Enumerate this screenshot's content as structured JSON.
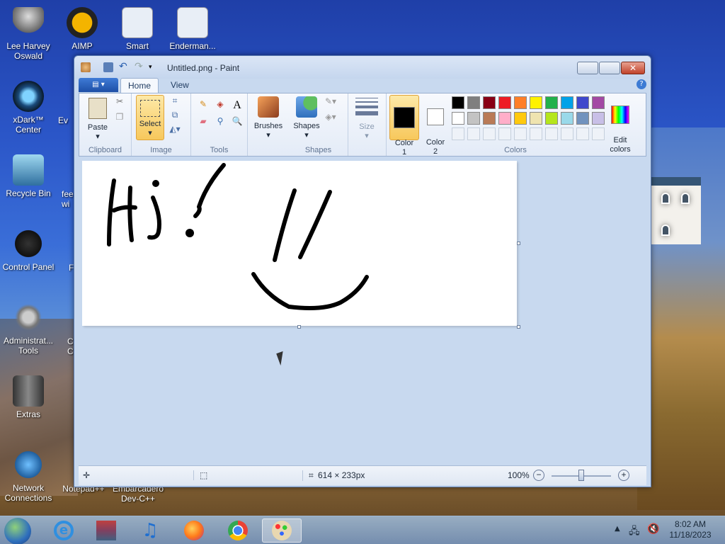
{
  "desktop": {
    "icons": [
      {
        "label": "Lee Harvey\nOswald"
      },
      {
        "label": "AIMP"
      },
      {
        "label": "Smart"
      },
      {
        "label": "Enderman..."
      },
      {
        "label": "xDark™\nCenter"
      },
      {
        "label": "Recycle Bin"
      },
      {
        "label": "Control Panel"
      },
      {
        "label": "Administrat...\nTools"
      },
      {
        "label": "Extras"
      },
      {
        "label": "Network\nConnections"
      },
      {
        "label": "Notepad++"
      },
      {
        "label": "Embarcadero\nDev-C++"
      }
    ],
    "partial_labels": [
      "Ev",
      "fee\nwi",
      "F",
      "C\nC"
    ]
  },
  "paint": {
    "title": "Untitled.png - Paint",
    "tabs": {
      "home": "Home",
      "view": "View"
    },
    "clipboard": {
      "paste": "Paste",
      "group": "Clipboard"
    },
    "image": {
      "select": "Select",
      "group": "Image"
    },
    "tools": {
      "group": "Tools"
    },
    "brushes": {
      "label": "Brushes"
    },
    "shapes": {
      "label": "Shapes",
      "group": "Shapes"
    },
    "size": {
      "label": "Size"
    },
    "color1": {
      "label": "Color\n1",
      "value": "#000000"
    },
    "color2": {
      "label": "Color\n2",
      "value": "#ffffff"
    },
    "colors": {
      "group": "Colors",
      "edit": "Edit\ncolors"
    },
    "palette_row1": [
      "#000000",
      "#7f7f7f",
      "#880015",
      "#ed1c24",
      "#ff7f27",
      "#fff200",
      "#22b14c",
      "#00a2e8",
      "#3f48cc",
      "#a349a4"
    ],
    "palette_row2": [
      "#ffffff",
      "#c3c3c3",
      "#b97a57",
      "#ffaec9",
      "#ffc90e",
      "#efe4b0",
      "#b5e61d",
      "#99d9ea",
      "#7092be",
      "#c8bfe7"
    ],
    "canvas_text": "Hi!",
    "status": {
      "size": "614 × 233px",
      "zoom": "100%"
    }
  },
  "taskbar": {
    "time": "8:02 AM",
    "date": "11/18/2023"
  }
}
